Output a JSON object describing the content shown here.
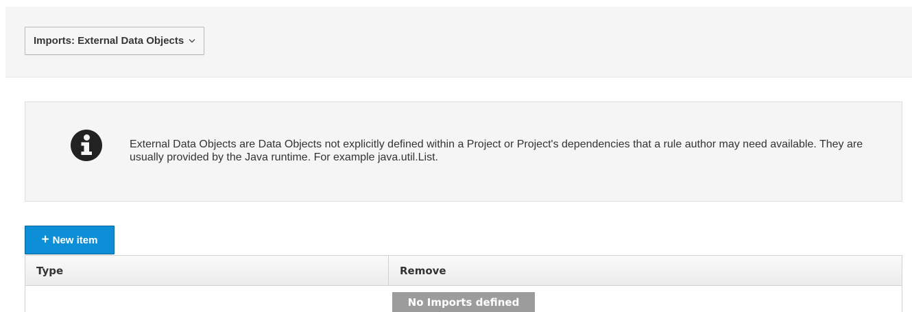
{
  "toolbar": {
    "dropdown_label": "Imports: External Data Objects",
    "dropdown_icon": "chevron-down-icon"
  },
  "info": {
    "icon": "info-circle-icon",
    "text": "External Data Objects are Data Objects not explicitly defined within a Project or Project's dependencies that a rule author may need available. They are usually provided by the Java runtime. For example java.util.List."
  },
  "actions": {
    "new_item_label": "New item",
    "new_item_icon": "plus-icon",
    "accent_color": "#0d8fd8"
  },
  "table": {
    "columns": [
      "Type",
      "Remove"
    ],
    "rows": [],
    "empty_message": "No Imports defined"
  }
}
